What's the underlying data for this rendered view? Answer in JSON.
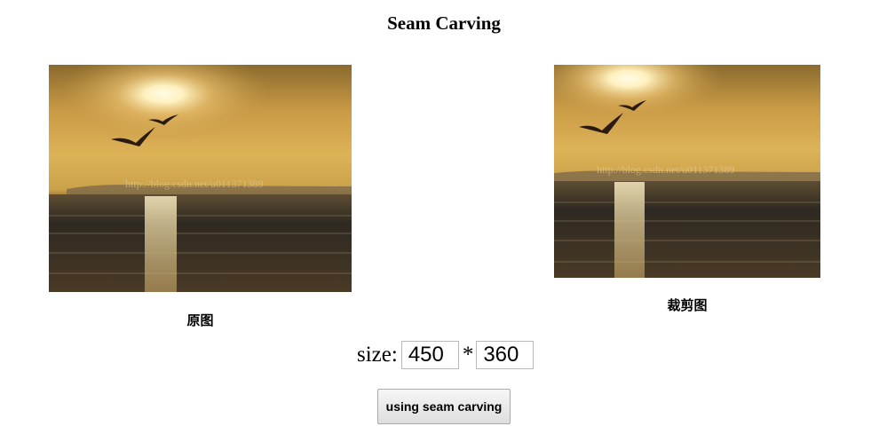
{
  "page": {
    "title": "Seam Carving"
  },
  "images": {
    "original": {
      "caption": "原图",
      "watermark": "http://blog.csdn.net/u011371389"
    },
    "cropped": {
      "caption": "裁剪图",
      "watermark": "http://blog.csdn.net/u011371389"
    }
  },
  "size": {
    "label": "size:",
    "separator": "*",
    "width_value": "450",
    "height_value": "360"
  },
  "actions": {
    "seam_button_label": "using seam carving"
  },
  "colors": {
    "sky": "#d9ae55",
    "sun": "#fff6d8",
    "sea": "#2f2a22"
  }
}
